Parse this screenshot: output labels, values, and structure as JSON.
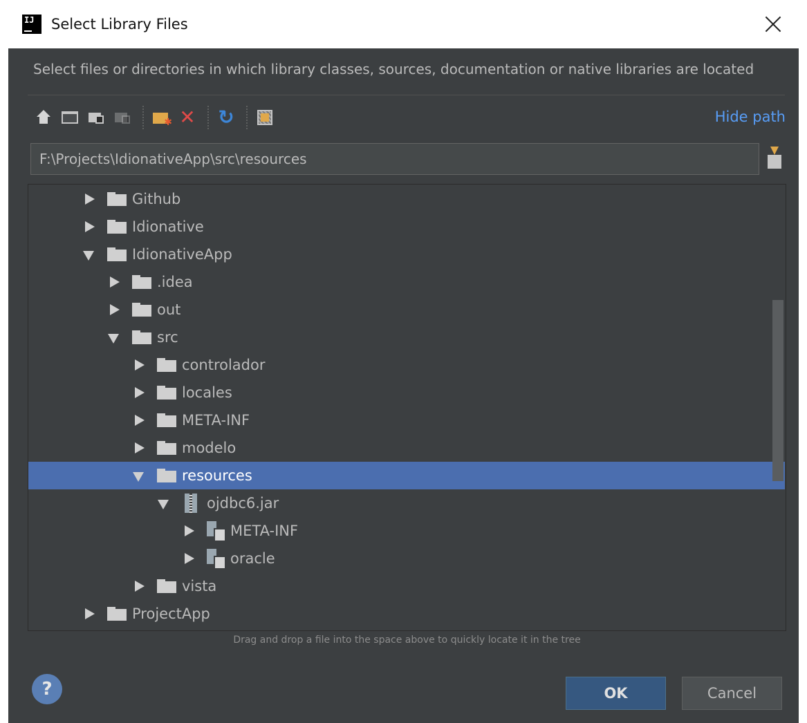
{
  "window": {
    "app_icon_text": "IJ",
    "title": "Select Library Files"
  },
  "description": "Select files or directories in which library classes, sources, documentation or native libraries are located",
  "toolbar": {
    "buttons": [
      {
        "icon": "home-icon"
      },
      {
        "icon": "desktop-icon"
      },
      {
        "icon": "project-icon"
      },
      {
        "icon": "module-icon"
      },
      {
        "icon": "new-folder-icon"
      },
      {
        "icon": "delete-icon"
      },
      {
        "icon": "refresh-icon"
      },
      {
        "icon": "show-hidden-icon"
      }
    ],
    "hide_path_label": "Hide path"
  },
  "path": {
    "value": "F:\\Projects\\IdionativeApp\\src\\resources"
  },
  "tree": {
    "rows": [
      {
        "label": "Github",
        "expanded": false,
        "level": 0,
        "type": "folder"
      },
      {
        "label": "Idionative",
        "expanded": false,
        "level": 0,
        "type": "folder"
      },
      {
        "label": "IdionativeApp",
        "expanded": true,
        "level": 0,
        "type": "folder"
      },
      {
        "label": ".idea",
        "expanded": false,
        "level": 1,
        "type": "folder"
      },
      {
        "label": "out",
        "expanded": false,
        "level": 1,
        "type": "folder"
      },
      {
        "label": "src",
        "expanded": true,
        "level": 1,
        "type": "folder"
      },
      {
        "label": "controlador",
        "expanded": false,
        "level": 2,
        "type": "folder"
      },
      {
        "label": "locales",
        "expanded": false,
        "level": 2,
        "type": "folder"
      },
      {
        "label": "META-INF",
        "expanded": false,
        "level": 2,
        "type": "folder"
      },
      {
        "label": "modelo",
        "expanded": false,
        "level": 2,
        "type": "folder"
      },
      {
        "label": "resources",
        "expanded": true,
        "level": 2,
        "type": "folder",
        "selected": true
      },
      {
        "label": "ojdbc6.jar",
        "expanded": true,
        "level": 3,
        "type": "jar"
      },
      {
        "label": "META-INF",
        "expanded": false,
        "level": 4,
        "type": "package"
      },
      {
        "label": "oracle",
        "expanded": false,
        "level": 4,
        "type": "package"
      },
      {
        "label": "vista",
        "expanded": false,
        "level": 2,
        "type": "folder"
      },
      {
        "label": "ProjectApp",
        "expanded": false,
        "level": 0,
        "type": "folder"
      }
    ]
  },
  "hint": "Drag and drop a file into the space above to quickly locate it in the tree",
  "footer": {
    "help_label": "?",
    "ok_label": "OK",
    "cancel_label": "Cancel"
  },
  "colors": {
    "background": "#3c3f41",
    "selection": "#4b6eaf",
    "link": "#589df6",
    "ok_button": "#365880"
  }
}
